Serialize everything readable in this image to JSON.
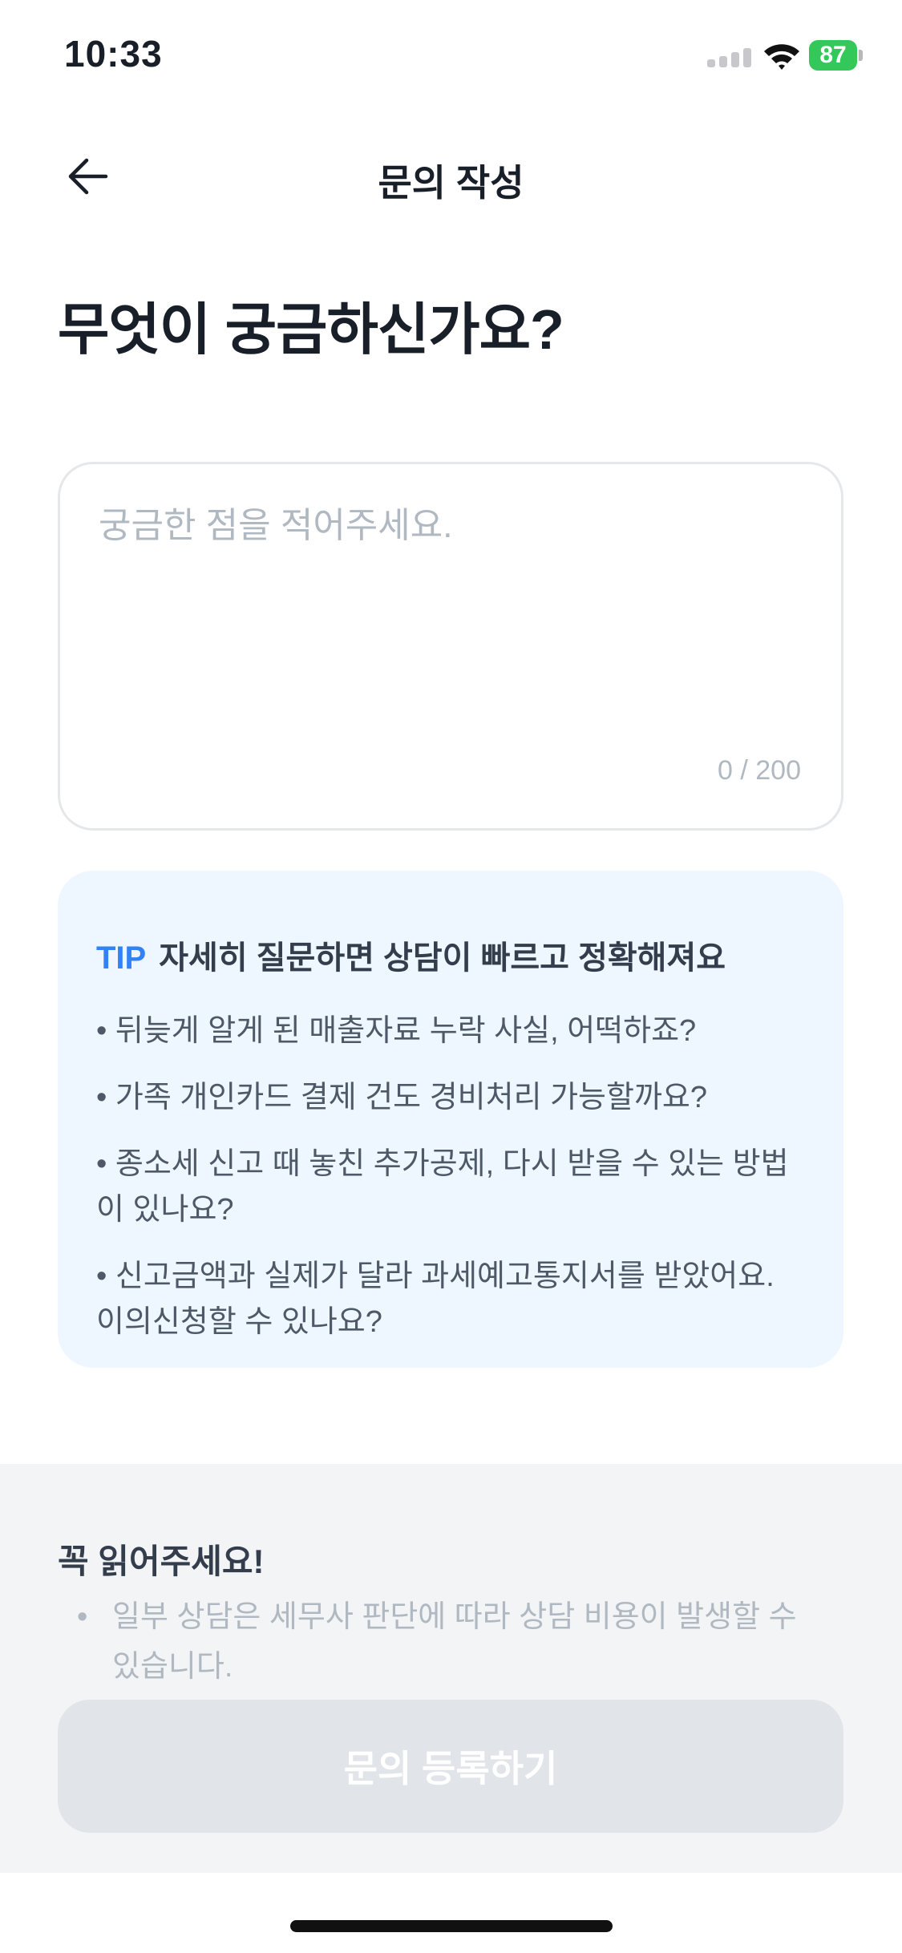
{
  "status_bar": {
    "time": "10:33",
    "battery": "87"
  },
  "nav": {
    "title": "문의 작성"
  },
  "heading": "무엇이 궁금하신가요?",
  "question": {
    "placeholder": "궁금한 점을 적어주세요.",
    "value": "",
    "counter": "0 / 200"
  },
  "tip": {
    "label": "TIP",
    "headline": "자세히 질문하면 상담이 빠르고 정확해져요",
    "examples": [
      "• 뒤늦게 알게 된 매출자료 누락 사실, 어떡하죠?",
      "• 가족 개인카드 결제 건도 경비처리 가능할까요?",
      "• 종소세 신고 때 놓친 추가공제, 다시 받을 수 있는 방법이 있나요?",
      "• 신고금액과 실제가 달라 과세예고통지서를 받았어요. 이의신청할 수 있나요?"
    ]
  },
  "notice": {
    "title": "꼭 읽어주세요!",
    "bullet": "•",
    "items": [
      "일부 상담은 세무사 판단에 따라 상담 비용이 발생할 수 있습니다."
    ]
  },
  "submit": {
    "label": "문의 등록하기",
    "enabled": false
  },
  "colors": {
    "accent": "#3182f6",
    "tip_bg": "#eef6ff",
    "disabled_button": "#e1e4e8",
    "battery": "#34c759"
  }
}
